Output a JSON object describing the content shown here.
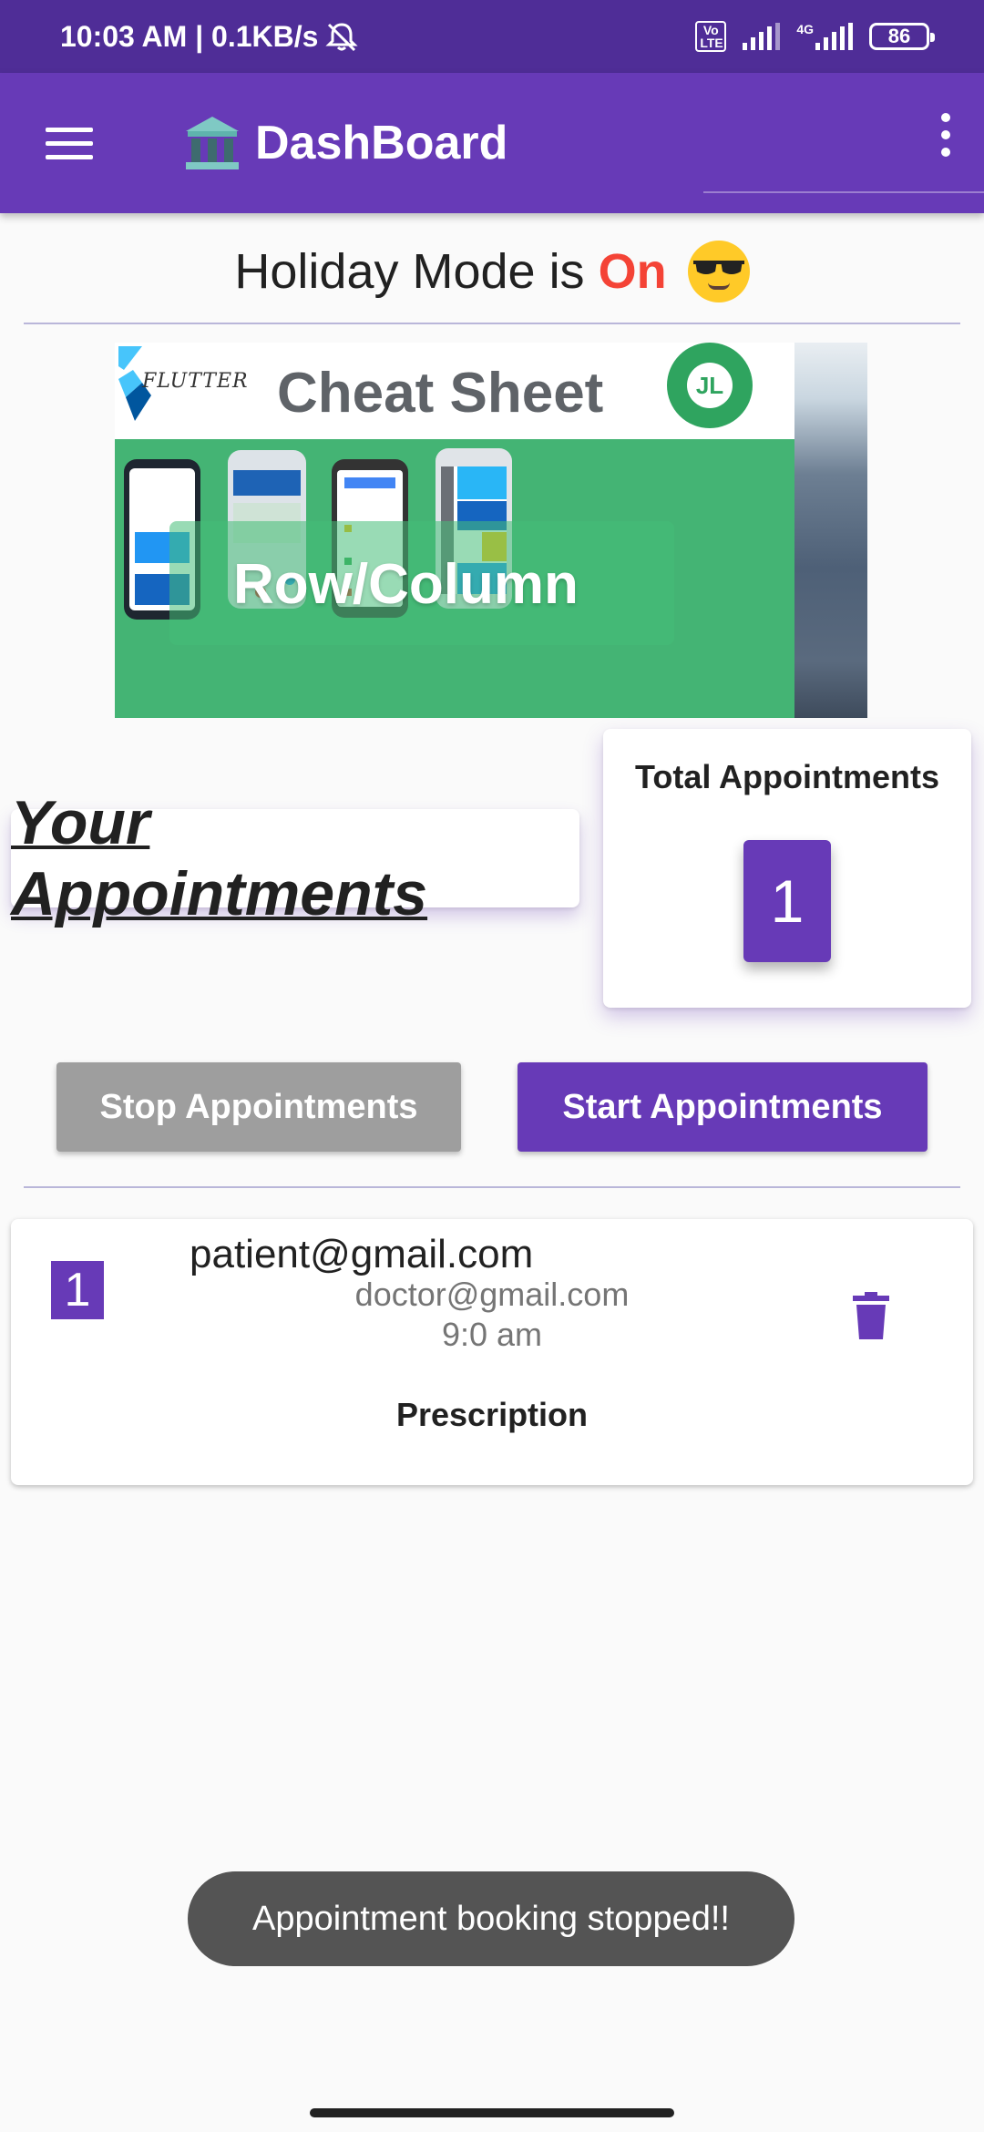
{
  "status_bar": {
    "time_speed": "10:03 AM | 0.1KB/s",
    "network_label": "4G",
    "volte_label": "Vo LTE",
    "battery": "86"
  },
  "app_bar": {
    "title": "DashBoard"
  },
  "holiday": {
    "prefix": "Holiday Mode is ",
    "state": "On"
  },
  "banner": {
    "flutter_label": "FLUTTER",
    "title": "Cheat Sheet",
    "badge": "JL",
    "caption": "Row/Column"
  },
  "appointments": {
    "section_title": "Your Appointments",
    "total_label": "Total Appointments",
    "total_count": "1",
    "stop_label": "Stop Appointments",
    "start_label": "Start Appointments",
    "items": [
      {
        "number": "1",
        "patient": "patient@gmail.com",
        "doctor": "doctor@gmail.com",
        "time": "9:0 am",
        "action": "Prescription"
      }
    ]
  },
  "toast": {
    "message": "Appointment booking stopped!!"
  },
  "colors": {
    "primary": "#673ab7",
    "status_bar": "#4f2d97",
    "on_state": "#f44336",
    "disabled_button": "#9e9e9e",
    "toast_bg": "#545454"
  },
  "icons": [
    "menu-icon",
    "bank-icon",
    "overflow-menu-icon",
    "silent-bell-icon",
    "signal-icon",
    "battery-icon",
    "cool-face-emoji-icon",
    "trash-icon"
  ]
}
